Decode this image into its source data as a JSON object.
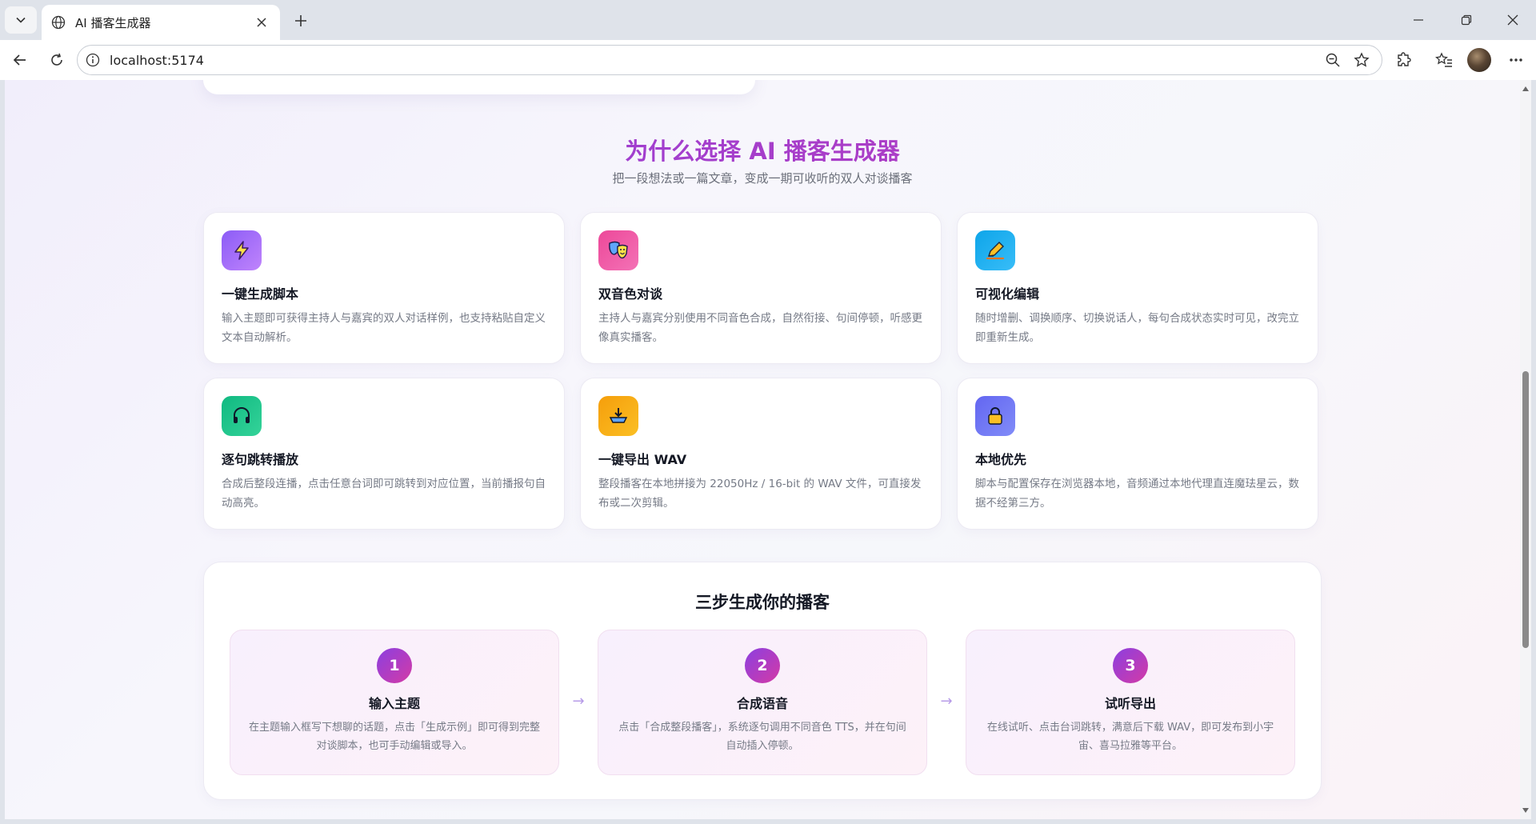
{
  "browser": {
    "tab_title": "AI 播客生成器",
    "url": "localhost:5174"
  },
  "features": {
    "title": "为什么选择 AI 播客生成器",
    "subtitle": "把一段想法或一篇文章，变成一期可收听的双人对谈播客",
    "cards": [
      {
        "title": "一键生成脚本",
        "desc": "输入主题即可获得主持人与嘉宾的双人对话样例，也支持粘贴自定义文本自动解析。",
        "icon": "lightning-icon",
        "color": "#8b5cf6"
      },
      {
        "title": "双音色对谈",
        "desc": "主持人与嘉宾分别使用不同音色合成，自然衔接、句间停顿，听感更像真实播客。",
        "icon": "theater-masks-icon",
        "color": "#ec4899"
      },
      {
        "title": "可视化编辑",
        "desc": "随时增删、调换顺序、切换说话人，每句合成状态实时可见，改完立即重新生成。",
        "icon": "pencil-icon",
        "color": "#0ea5e9"
      },
      {
        "title": "逐句跳转播放",
        "desc": "合成后整段连播，点击任意台词即可跳转到对应位置，当前播报句自动高亮。",
        "icon": "headphones-icon",
        "color": "#10b981"
      },
      {
        "title": "一键导出 WAV",
        "desc": "整段播客在本地拼接为 22050Hz / 16-bit 的 WAV 文件，可直接发布或二次剪辑。",
        "icon": "download-tray-icon",
        "color": "#f59e0b"
      },
      {
        "title": "本地优先",
        "desc": "脚本与配置保存在浏览器本地，音频通过本地代理直连魔珐星云，数据不经第三方。",
        "icon": "lock-icon",
        "color": "#6366f1"
      }
    ]
  },
  "steps": {
    "title": "三步生成你的播客",
    "items": [
      {
        "num": "1",
        "title": "输入主题",
        "desc": "在主题输入框写下想聊的话题，点击「生成示例」即可得到完整对谈脚本，也可手动编辑或导入。"
      },
      {
        "num": "2",
        "title": "合成语音",
        "desc": "点击「合成整段播客」，系统逐句调用不同音色 TTS，并在句间自动插入停顿。"
      },
      {
        "num": "3",
        "title": "试听导出",
        "desc": "在线试听、点击台词跳转，满意后下载 WAV，即可发布到小宇宙、喜马拉雅等平台。"
      }
    ],
    "arrow": "→"
  }
}
